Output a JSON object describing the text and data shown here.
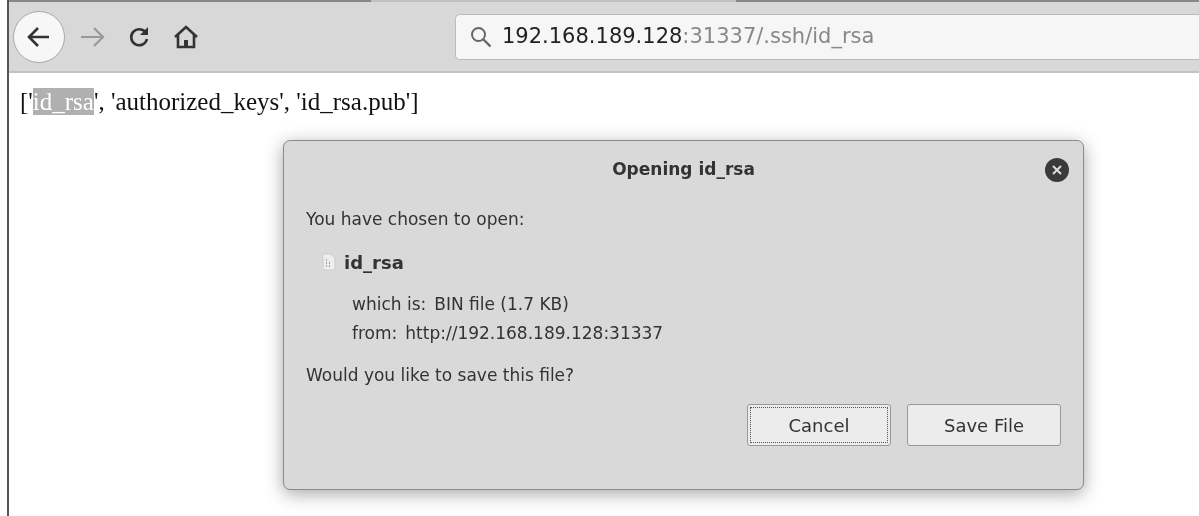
{
  "toolbar": {
    "address": {
      "host": "192.168.189.128",
      "rest": ":31337/.ssh/id_rsa"
    }
  },
  "page": {
    "segments": [
      {
        "text": "['",
        "selected": false
      },
      {
        "text": "id_rsa",
        "selected": true
      },
      {
        "text": "', 'authorized_keys', 'id_rsa.pub']",
        "selected": false
      }
    ]
  },
  "dialog": {
    "title": "Opening id_rsa",
    "intro": "You have chosen to open:",
    "file_name": "id_rsa",
    "details": [
      {
        "label": "which is:",
        "value": "BIN file (1.7 KB)"
      },
      {
        "label": "from:",
        "value": "http://192.168.189.128:31337"
      }
    ],
    "question": "Would you like to save this file?",
    "buttons": [
      {
        "label": "Cancel",
        "focused": true
      },
      {
        "label": "Save File",
        "focused": false
      }
    ]
  }
}
